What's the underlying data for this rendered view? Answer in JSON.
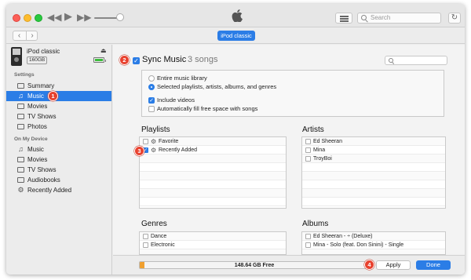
{
  "window": {
    "title_icon": "apple-logo",
    "search_placeholder": "Search",
    "device_pill": "iPod classic"
  },
  "device": {
    "name": "iPod classic",
    "capacity": "160GB",
    "battery_level": 0.8
  },
  "sidebar": {
    "settings_header": "Settings",
    "settings_items": [
      {
        "label": "Summary",
        "icon": "summary-icon"
      },
      {
        "label": "Music",
        "icon": "music-note-icon",
        "selected": true
      },
      {
        "label": "Movies",
        "icon": "movies-icon"
      },
      {
        "label": "TV Shows",
        "icon": "tv-icon"
      },
      {
        "label": "Photos",
        "icon": "camera-icon"
      }
    ],
    "device_header": "On My Device",
    "device_items": [
      {
        "label": "Music",
        "icon": "music-note-icon"
      },
      {
        "label": "Movies",
        "icon": "movies-icon"
      },
      {
        "label": "TV Shows",
        "icon": "tv-icon"
      },
      {
        "label": "Audiobooks",
        "icon": "audiobook-icon"
      },
      {
        "label": "Recently Added",
        "icon": "gear-icon"
      }
    ]
  },
  "sync": {
    "title": "Sync Music",
    "count": "3 songs",
    "options": {
      "entire_library": "Entire music library",
      "selected": "Selected playlists, artists, albums, and genres",
      "include_videos": "Include videos",
      "autofill": "Automatically fill free space with songs"
    }
  },
  "playlists": {
    "title": "Playlists",
    "items": [
      {
        "label": "Favorite",
        "checked": false
      },
      {
        "label": "Recently Added",
        "checked": true
      }
    ]
  },
  "artists": {
    "title": "Artists",
    "items": [
      {
        "label": "Ed Sheeran"
      },
      {
        "label": "Mina"
      },
      {
        "label": "TroyBoi"
      }
    ]
  },
  "genres": {
    "title": "Genres",
    "items": [
      {
        "label": "Dance"
      },
      {
        "label": "Electronic"
      }
    ]
  },
  "albums": {
    "title": "Albums",
    "items": [
      {
        "label": "Ed Sheeran - ÷ (Deluxe)"
      },
      {
        "label": "Mina - Solo (feat. Don Sinini) - Single"
      }
    ]
  },
  "footer": {
    "storage_text": "148.64 GB Free",
    "storage_used_fraction": 0.01,
    "apply": "Apply",
    "done": "Done"
  },
  "steps": [
    "1",
    "2",
    "3",
    "4"
  ],
  "colors": {
    "accent": "#2b7de6",
    "step_badge": "#e8412e",
    "storage_used": "#f0a030"
  }
}
